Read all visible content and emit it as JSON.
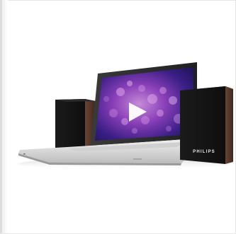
{
  "speaker": {
    "brand": "PHILIPS"
  },
  "screen": {
    "content": "play-icon"
  },
  "colors": {
    "background": "#ffffff",
    "speaker_cabinet": "#171717",
    "speaker_side": "#5a3a2c",
    "screen_glow": "#b06ad0",
    "screen_base": "#2a1a66",
    "laptop_body": "#d8d8d8"
  }
}
